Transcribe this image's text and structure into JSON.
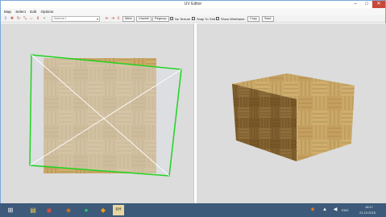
{
  "window": {
    "title": "UV Editor",
    "min": "–",
    "max": "□",
    "close": "✕"
  },
  "menu": [
    "Map",
    "Select",
    "Edit",
    "Options"
  ],
  "toolbar": {
    "material_value": "Material 1",
    "weld": "Weld",
    "unweld": "Unweld",
    "regroup": "Regroup",
    "no_texture": "No Texture",
    "snap_to_grid": "Snap To Grid",
    "show_wireframe": "Show Wireframe",
    "copy": "Copy",
    "save": "Save"
  },
  "colors": {
    "uv_border": "#1fd41f",
    "uv_lines": "#ffffff",
    "viewport_bg": "#dcdcdc",
    "taskbar": "#3d5a7a"
  },
  "taskbar": {
    "items": [
      "start-icon",
      "explorer-icon",
      "chrome-icon",
      "media-icon",
      "app-icon",
      "app2-icon",
      "kh-icon"
    ],
    "kh_label": "KH",
    "lang": "ENG",
    "time": "18:17",
    "date": "21.10.2015"
  }
}
